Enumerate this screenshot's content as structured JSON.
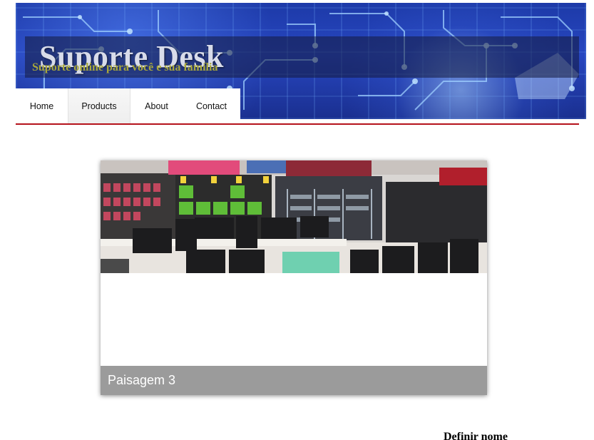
{
  "header": {
    "title": "Suporte Desk",
    "subtitle": "Suporte online para você e sua família"
  },
  "nav": {
    "items": [
      {
        "label": "Home"
      },
      {
        "label": "Products"
      },
      {
        "label": "About"
      },
      {
        "label": "Contact"
      }
    ],
    "active_index": 1
  },
  "slider": {
    "caption": "Paisagem 3"
  },
  "footer": {
    "name_text": "Definir nome"
  },
  "colors": {
    "accent_rule": "#b5121b",
    "caption_bar": "#9b9b9b",
    "header_blue": "#2746c0"
  }
}
